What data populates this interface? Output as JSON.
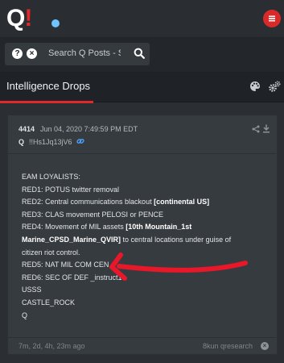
{
  "header": {
    "logo_letter": "Q",
    "logo_mark": "!",
    "menu_icon": "hamburger-menu-icon",
    "brand_red": "#e02a2a",
    "dot_color": "#6fc3ff"
  },
  "search": {
    "placeholder": "Search Q Posts - Search",
    "help_glyph": "?",
    "clear_glyph": "×"
  },
  "tabs": {
    "title": "Intelligence Drops",
    "icons": [
      "palette-icon",
      "gears-icon"
    ]
  },
  "post": {
    "number": "4414",
    "date": "Jun 04, 2020 7:49:59 PM EDT",
    "author": "Q",
    "tripcode": "!!Hs1Jq13jV6",
    "lines": [
      {
        "pre": "EAM LOYALISTS:",
        "bold": "",
        "post": ""
      },
      {
        "pre": "RED1: POTUS twitter removal",
        "bold": "",
        "post": ""
      },
      {
        "pre": "RED2: Central communications blackout ",
        "bold": "[continental US]",
        "post": ""
      },
      {
        "pre": "RED3: CLAS movement PELOSI or PENCE",
        "bold": "",
        "post": ""
      },
      {
        "pre": "RED4: Movement of MIL assets ",
        "bold": "[10th Mountain_1st",
        "post": ""
      },
      {
        "pre": "",
        "bold": "Marine_CPSD_Marine_QVIR]",
        "post": " to central locations under guise of"
      },
      {
        "pre": "citizen riot control.",
        "bold": "",
        "post": ""
      },
      {
        "pre": "RED5: NAT MIL COM CEN",
        "bold": "",
        "post": ""
      },
      {
        "pre": "RED6: SEC OF DEF _instruct1",
        "bold": "",
        "post": ""
      },
      {
        "pre": "USSS",
        "bold": "",
        "post": ""
      },
      {
        "pre": "CASTLE_ROCK",
        "bold": "",
        "post": ""
      },
      {
        "pre": "Q",
        "bold": "",
        "post": ""
      }
    ],
    "age": "7m, 2d, 4h, 23m ago",
    "source": "8kun qresearch",
    "source_close": "×"
  },
  "annotation": {
    "arrow_color": "#e8182a"
  }
}
